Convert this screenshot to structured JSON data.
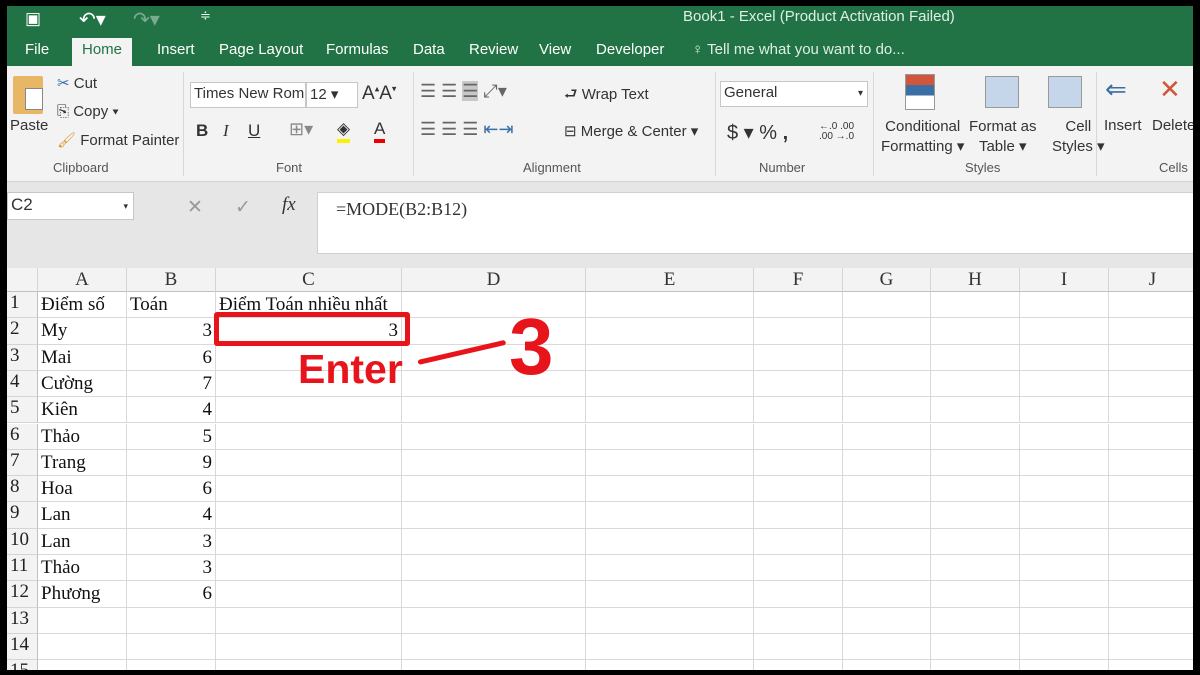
{
  "title": "Book1 - Excel (Product Activation Failed)",
  "tabs": [
    "File",
    "Home",
    "Insert",
    "Page Layout",
    "Formulas",
    "Data",
    "Review",
    "View",
    "Developer"
  ],
  "tell_me": "Tell me what you want to do...",
  "clipboard": {
    "paste": "Paste",
    "cut": "Cut",
    "copy": "Copy",
    "format_painter": "Format Painter",
    "group": "Clipboard"
  },
  "font": {
    "name": "Times New Roman",
    "size": "12",
    "bold": "B",
    "italic": "I",
    "underline": "U",
    "group": "Font"
  },
  "alignment": {
    "wrap": "Wrap Text",
    "merge": "Merge & Center",
    "group": "Alignment"
  },
  "number": {
    "format": "General",
    "dollar": "$",
    "percent": "%",
    "comma": ",",
    "group": "Number"
  },
  "styles": {
    "conditional": "Conditional",
    "conditional2": "Formatting",
    "format_as": "Format as",
    "format_as2": "Table",
    "cell": "Cell",
    "cell2": "Styles",
    "group": "Styles"
  },
  "cells": {
    "insert": "Insert",
    "delete": "Delete",
    "group": "Cells"
  },
  "name_box": "C2",
  "formula": "=MODE(B2:B12)",
  "columns": [
    "A",
    "B",
    "C",
    "D",
    "E",
    "F",
    "G",
    "H",
    "I",
    "J"
  ],
  "rows": [
    [
      "Điểm số",
      "Toán",
      "Điểm Toán nhiều nhất"
    ],
    [
      "My",
      "3",
      "3"
    ],
    [
      "Mai",
      "6",
      ""
    ],
    [
      "Cường",
      "7",
      ""
    ],
    [
      "Kiên",
      "4",
      ""
    ],
    [
      "Thảo",
      "5",
      ""
    ],
    [
      "Trang",
      "9",
      ""
    ],
    [
      "Hoa",
      "6",
      ""
    ],
    [
      "Lan",
      "4",
      ""
    ],
    [
      "Lan",
      "3",
      ""
    ],
    [
      "Thảo",
      "3",
      ""
    ],
    [
      "Phương",
      "6",
      ""
    ],
    [
      "",
      "",
      ""
    ],
    [
      "",
      "",
      ""
    ],
    [
      "",
      "",
      ""
    ]
  ],
  "annotation": {
    "label": "Enter",
    "result": "3",
    "color": "#e8141b"
  },
  "colors": {
    "brand": "#217346"
  }
}
